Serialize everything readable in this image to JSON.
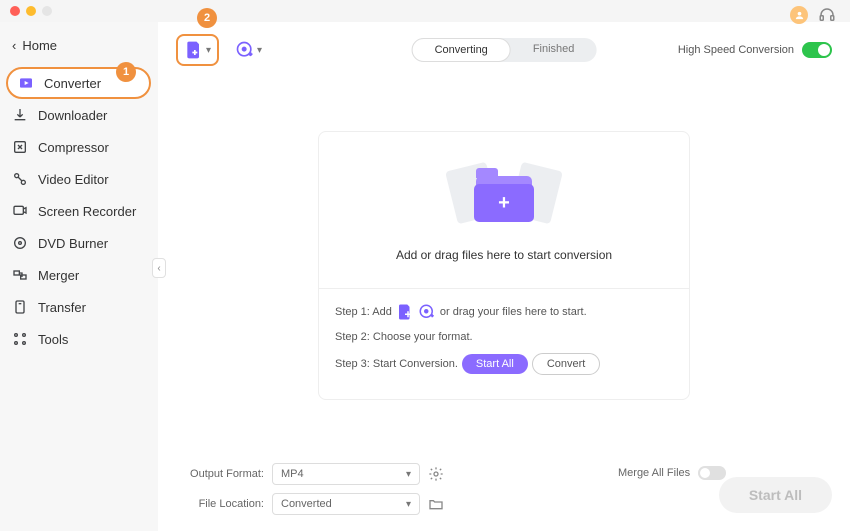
{
  "header": {
    "home_label": "Home"
  },
  "sidebar": {
    "items": [
      {
        "label": "Converter",
        "icon": "converter-icon",
        "selected": true
      },
      {
        "label": "Downloader",
        "icon": "downloader-icon"
      },
      {
        "label": "Compressor",
        "icon": "compressor-icon"
      },
      {
        "label": "Video Editor",
        "icon": "editor-icon"
      },
      {
        "label": "Screen Recorder",
        "icon": "recorder-icon"
      },
      {
        "label": "DVD Burner",
        "icon": "dvd-icon"
      },
      {
        "label": "Merger",
        "icon": "merger-icon"
      },
      {
        "label": "Transfer",
        "icon": "transfer-icon"
      },
      {
        "label": "Tools",
        "icon": "tools-icon"
      }
    ]
  },
  "callouts": {
    "one": "1",
    "two": "2"
  },
  "toolbar": {
    "tabs": {
      "converting": "Converting",
      "finished": "Finished"
    },
    "high_speed_label": "High Speed Conversion",
    "high_speed_enabled": true
  },
  "dropzone": {
    "main_text": "Add or drag files here to start conversion",
    "step1_prefix": "Step 1: Add",
    "step1_suffix": "or drag your files here to start.",
    "step2": "Step 2: Choose your format.",
    "step3": "Step 3: Start Conversion.",
    "start_all_label": "Start  All",
    "convert_label": "Convert"
  },
  "footer": {
    "output_format_label": "Output Format:",
    "output_format_value": "MP4",
    "file_location_label": "File Location:",
    "file_location_value": "Converted",
    "merge_label": "Merge All Files",
    "merge_enabled": false,
    "start_all_label": "Start All"
  }
}
